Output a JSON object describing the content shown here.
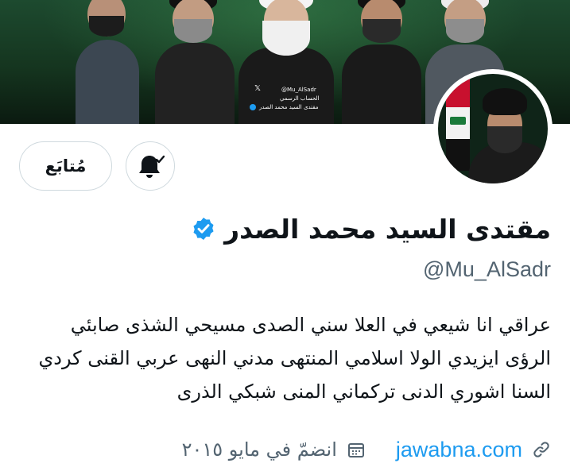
{
  "banner": {
    "watermark_handle": "@Mu_AlSadr",
    "watermark_line2": "الحساب الرسمي",
    "watermark_line3": "مقتدى السيد محمد الصدر"
  },
  "profile": {
    "display_name": "مقتدى السيد محمد الصدر",
    "handle": "@Mu_AlSadr",
    "follow_label": "مُتابَع",
    "verified": true
  },
  "bio": {
    "lines": [
      "عراقي انا شيعي في العلا سني الصدى مسيحي الشذى صابئي",
      "الرؤى ايزيدي الولا اسلامي المنتهى مدني النهى عربي القنى كردي",
      "السنا اشوري الدنى تركماني المنى شبكي الذرى"
    ]
  },
  "meta": {
    "link": "jawabna.com",
    "joined": "انضمّ في مايو ٢٠١٥"
  },
  "colors": {
    "accent": "#1d9bf0",
    "secondary_text": "#536471",
    "border": "#cfd9de"
  }
}
